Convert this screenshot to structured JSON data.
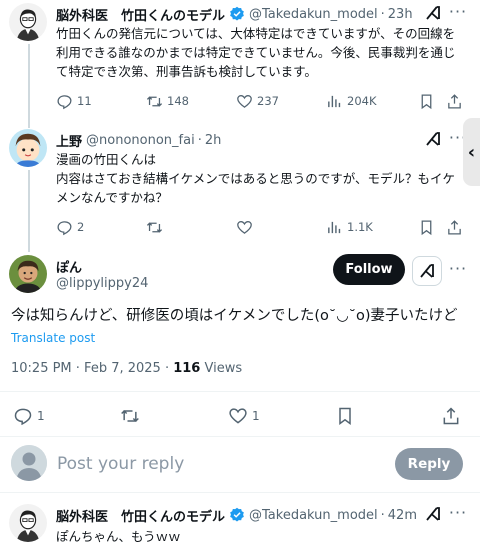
{
  "tweet1": {
    "author_name": "脳外科医　竹田くんのモデル",
    "handle": "@Takedakun_model",
    "time": "23h",
    "text": "竹田くんの発信元については、大体特定はできていますが、その回線を利用できる誰なのかまでは特定できていません。今後、民事裁判を通じて特定でき次第、刑事告訴も検討しています。",
    "replies": "11",
    "reposts": "148",
    "likes": "237",
    "views": "204K"
  },
  "tweet2": {
    "author_name": "上野",
    "handle": "@nonononon_fai",
    "time": "2h",
    "text_line1": "漫画の竹田くんは",
    "text_line2": "内容はさておき結構イケメンではあると思うのですが、モデル？もイケメンなんですかね？",
    "replies": "2",
    "views": "1.1K"
  },
  "focused": {
    "author_name": "ぽん",
    "handle": "@lippylippy24",
    "follow_label": "Follow",
    "text": "今は知らんけど、研修医の頃はイケメンでした(o˘◡˘o)妻子いたけど",
    "translate_label": "Translate post",
    "timestamp": "10:25 PM · Feb 7, 2025 · ",
    "views_count": "116",
    "views_label": " Views",
    "replies": "1",
    "likes": "1"
  },
  "reply_box": {
    "placeholder": "Post your reply",
    "button_label": "Reply"
  },
  "tweet3": {
    "author_name": "脳外科医　竹田くんのモデル",
    "handle": "@Takedakun_model",
    "time": "42m",
    "text": "ぽんちゃん、もうｗｗ"
  },
  "colors": {
    "accent": "#1d9bf0",
    "muted": "#536471",
    "text": "#0f1419"
  },
  "icons": [
    "reply-icon",
    "repost-icon",
    "like-icon",
    "views-icon",
    "bookmark-icon",
    "share-icon",
    "verified-icon",
    "grok-icon",
    "more-icon",
    "chevron-left-icon"
  ]
}
